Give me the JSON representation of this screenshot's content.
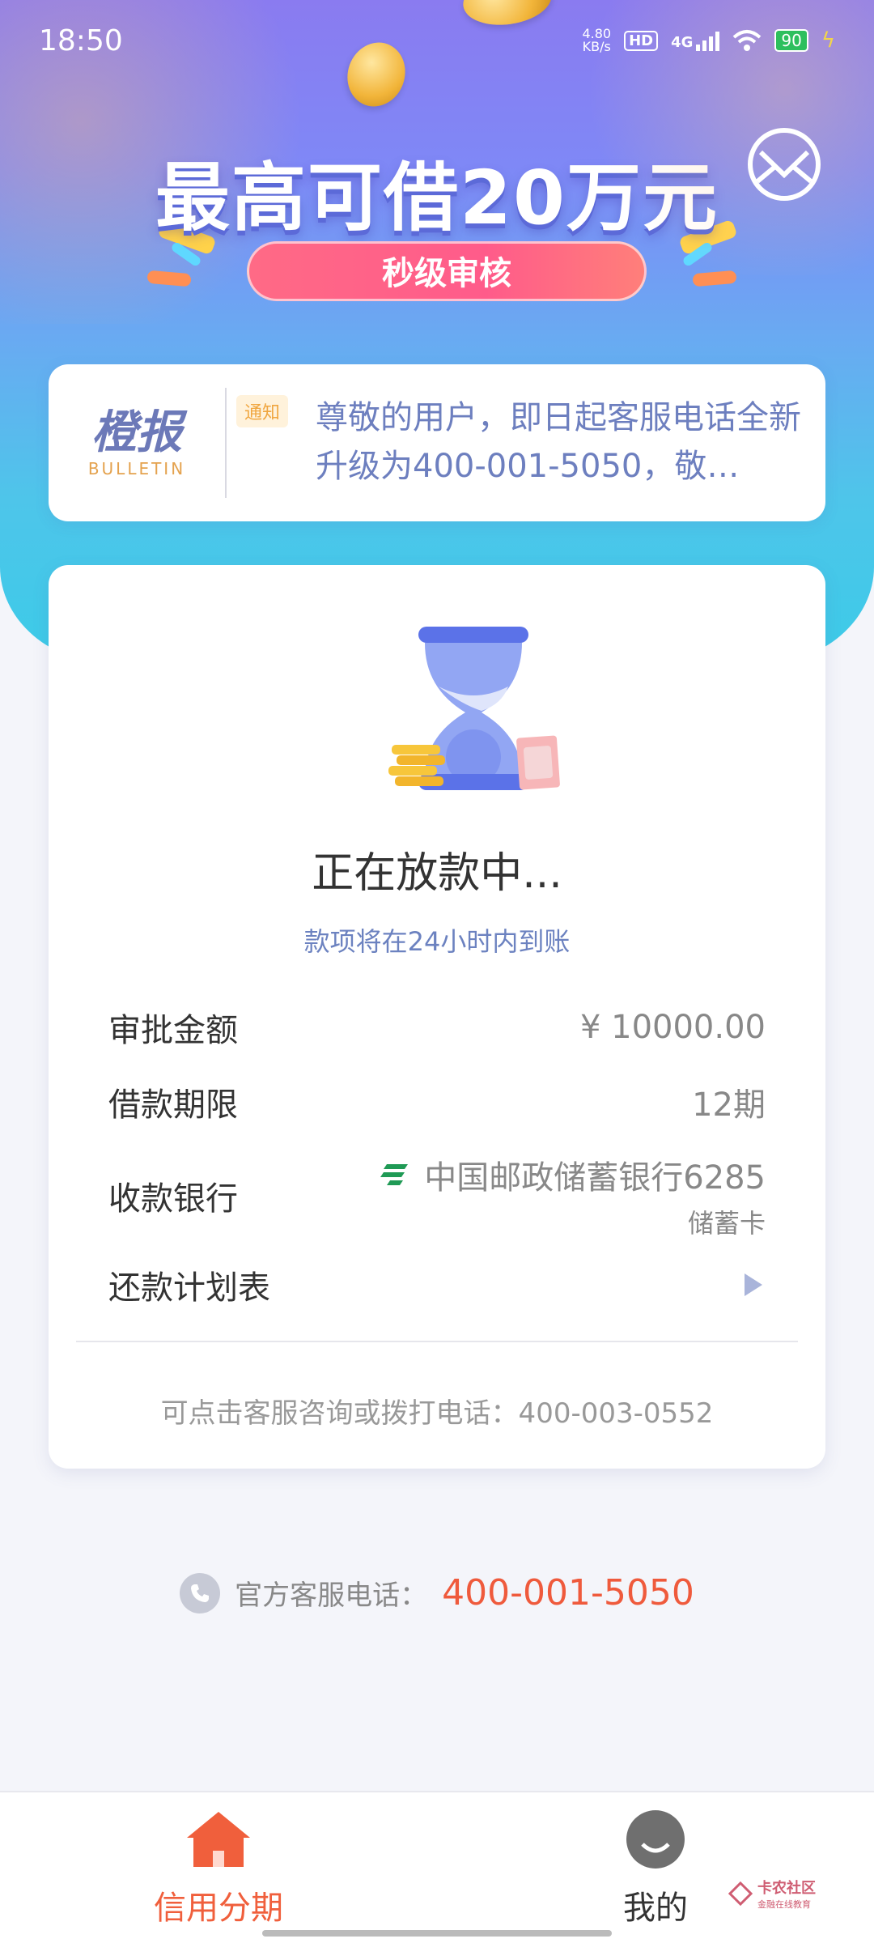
{
  "status_bar": {
    "time": "18:50",
    "net_speed_value": "4.80",
    "net_speed_unit": "KB/s",
    "hd": "HD",
    "network": "4G",
    "battery": "90"
  },
  "hero": {
    "title": "最高可借20万元",
    "pill": "秒级审核",
    "icons": [
      "coin-icon",
      "mail-icon"
    ]
  },
  "bulletin": {
    "logo_main": "橙报",
    "logo_sub": "BULLETIN",
    "tag": "通知",
    "text": "尊敬的用户，即日起客服电话全新升级为400-001-5050，敬…"
  },
  "loan_card": {
    "status_title": "正在放款中...",
    "status_sub": "款项将在24小时内到账",
    "rows": [
      {
        "label": "审批金额",
        "value": "¥ 10000.00"
      },
      {
        "label": "借款期限",
        "value": "12期"
      },
      {
        "label": "收款银行",
        "value": "中国邮政储蓄银行6285",
        "sub": "储蓄卡"
      },
      {
        "label": "还款计划表",
        "value": ""
      }
    ],
    "footer": "可点击客服咨询或拨打电话：400-003-0552"
  },
  "hotline": {
    "label": "官方客服电话：",
    "number": "400-001-5050"
  },
  "tabbar": {
    "tabs": [
      {
        "label": "信用分期",
        "active": true,
        "icon": "home-icon"
      },
      {
        "label": "我的",
        "active": false,
        "icon": "profile-icon"
      }
    ]
  },
  "watermark": {
    "title": "卡农社区",
    "sub": "金融在线教育"
  },
  "colors": {
    "accent": "#ef5a3c",
    "hotline_number": "#ef5a3c",
    "sub_text": "#6c82c0",
    "bulletin_text": "#6d7fbf"
  }
}
